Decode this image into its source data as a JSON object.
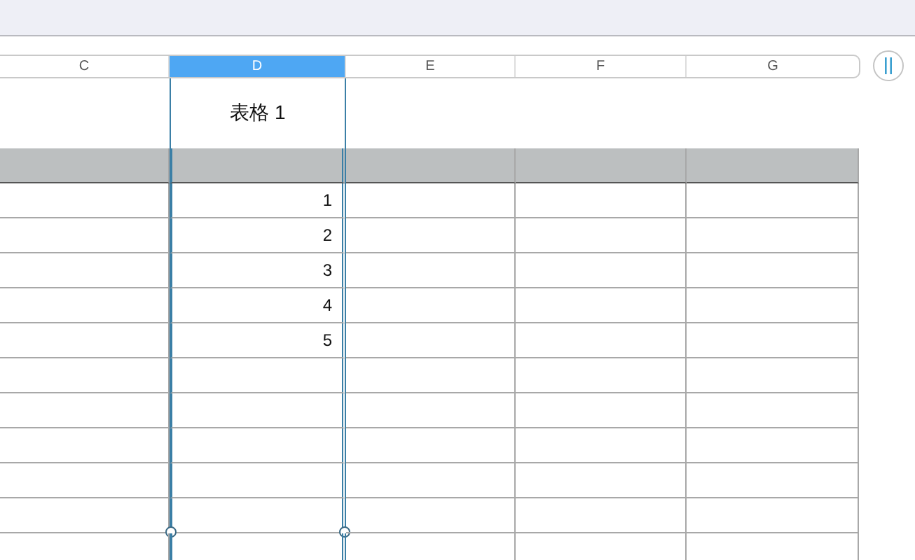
{
  "columns": [
    {
      "label": "C",
      "selected": false
    },
    {
      "label": "D",
      "selected": true
    },
    {
      "label": "E",
      "selected": false
    },
    {
      "label": "F",
      "selected": false
    },
    {
      "label": "G",
      "selected": false
    }
  ],
  "table": {
    "title": "表格 1",
    "rows": [
      {
        "value": "1"
      },
      {
        "value": "2"
      },
      {
        "value": "3"
      },
      {
        "value": "4"
      },
      {
        "value": "5"
      },
      {},
      {},
      {},
      {},
      {},
      {}
    ]
  }
}
